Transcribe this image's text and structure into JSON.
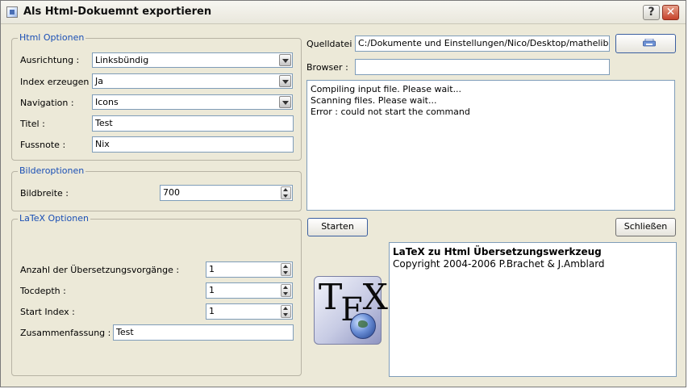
{
  "window": {
    "title": "Als Html-Dokuemnt exportieren",
    "help_label": "?",
    "close_label": "✕"
  },
  "html_options": {
    "legend": "Html Optionen",
    "alignment": {
      "label": "Ausrichtung :",
      "value": "Linksbündig"
    },
    "index": {
      "label": "Index erzeugen :",
      "value": "Ja"
    },
    "navigation": {
      "label": "Navigation :",
      "value": "Icons"
    },
    "title_field": {
      "label": "Titel :",
      "value": "Test"
    },
    "footnote": {
      "label": "Fussnote :",
      "value": "Nix"
    }
  },
  "image_options": {
    "legend": "Bilderoptionen",
    "width": {
      "label": "Bildbreite :",
      "value": "700"
    }
  },
  "latex_options": {
    "legend": "LaTeX Optionen",
    "passes": {
      "label": "Anzahl der Übersetzungsvorgänge :",
      "value": "1"
    },
    "tocdepth": {
      "label": "Tocdepth :",
      "value": "1"
    },
    "start_index": {
      "label": "Start Index :",
      "value": "1"
    },
    "summary": {
      "label": "Zusammenfassung :",
      "value": "Test"
    }
  },
  "source": {
    "label": "Quelldatei :",
    "value": "C:/Dokumente und Einstellungen/Nico/Desktop/mathelib.tex",
    "browse_icon": "printer-icon"
  },
  "browser": {
    "label": "Browser :",
    "value": ""
  },
  "log": [
    "Compiling input file. Please wait...",
    "Scanning files. Please wait...",
    "Error : could not start the command"
  ],
  "buttons": {
    "start": "Starten",
    "close": "Schließen"
  },
  "about": {
    "title": "LaTeX zu Html Übersetzungswerkzeug",
    "copyright": "Copyright 2004-2006 P.Brachet & J.Amblard"
  },
  "colors": {
    "window_bg": "#ece9d8",
    "legend_text": "#1a4fb5",
    "field_border": "#7f9db9"
  }
}
